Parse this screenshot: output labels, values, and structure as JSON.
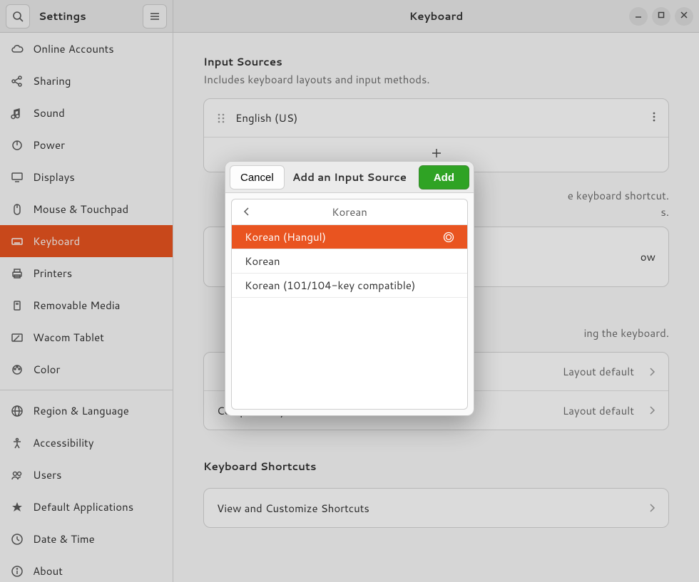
{
  "header": {
    "left_title": "Settings",
    "right_title": "Keyboard"
  },
  "sidebar": {
    "items": [
      {
        "icon": "cloud",
        "label": "Online Accounts"
      },
      {
        "icon": "share",
        "label": "Sharing"
      },
      {
        "icon": "sound",
        "label": "Sound"
      },
      {
        "icon": "power",
        "label": "Power"
      },
      {
        "icon": "displays",
        "label": "Displays"
      },
      {
        "icon": "mouse",
        "label": "Mouse & Touchpad"
      },
      {
        "icon": "keyboard",
        "label": "Keyboard",
        "selected": true
      },
      {
        "icon": "printers",
        "label": "Printers"
      },
      {
        "icon": "removable",
        "label": "Removable Media"
      },
      {
        "icon": "wacom",
        "label": "Wacom Tablet"
      },
      {
        "icon": "color",
        "label": "Color"
      },
      {
        "sep": true
      },
      {
        "icon": "region",
        "label": "Region & Language"
      },
      {
        "icon": "accessibility",
        "label": "Accessibility"
      },
      {
        "icon": "users",
        "label": "Users"
      },
      {
        "icon": "default",
        "label": "Default Applications"
      },
      {
        "icon": "date",
        "label": "Date & Time"
      },
      {
        "icon": "about",
        "label": "About"
      }
    ]
  },
  "main": {
    "input_sources": {
      "title": "Input Sources",
      "subtitle": "Includes keyboard layouts and input methods.",
      "items": [
        {
          "label": "English (US)"
        }
      ]
    },
    "switching": {
      "desc_line1_partial": "e keyboard shortcut.",
      "desc_line2_partial": "s."
    },
    "switching_row_partial": "ow",
    "special": {
      "title_fragment": "",
      "desc_fragment": "ing the keyboard.",
      "rows": [
        {
          "label": "",
          "value": "Layout default"
        },
        {
          "label": "Compose Key",
          "value": "Layout default"
        }
      ]
    },
    "shortcuts": {
      "title": "Keyboard Shortcuts",
      "row_label": "View and Customize Shortcuts"
    }
  },
  "dialog": {
    "cancel": "Cancel",
    "title": "Add an Input Source",
    "add": "Add",
    "category": "Korean",
    "items": [
      {
        "label": "Korean (Hangul)",
        "selected": true,
        "ime": true
      },
      {
        "label": "Korean"
      },
      {
        "label": "Korean (101/104-key compatible)"
      }
    ]
  }
}
